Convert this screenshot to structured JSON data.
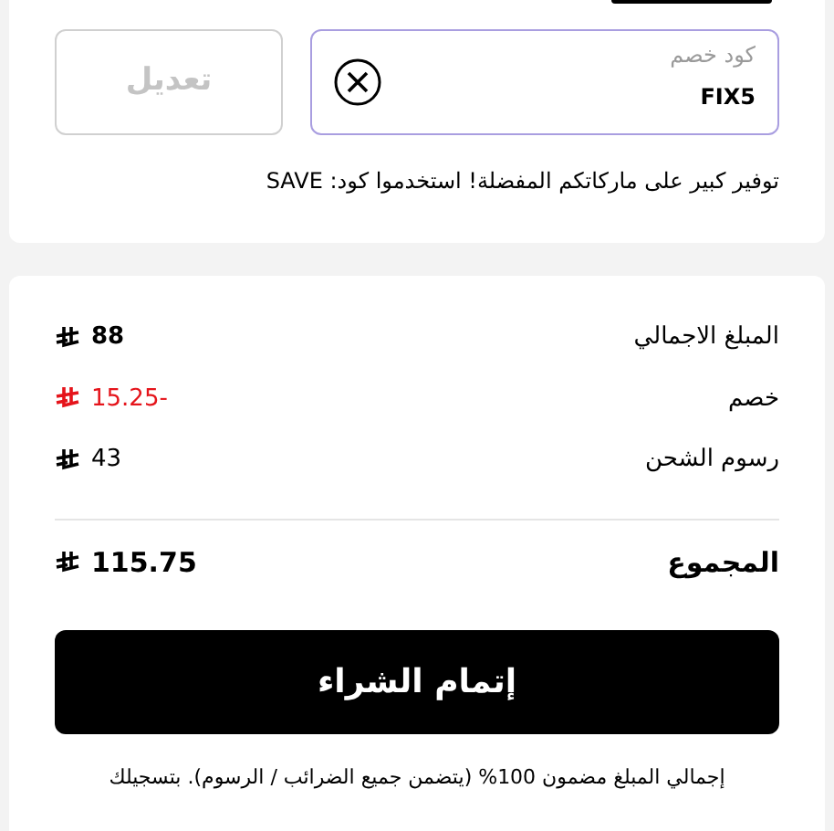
{
  "coupon": {
    "label": "كود خصم",
    "value": "FIX5",
    "edit_button": {
      "label": "تعديل",
      "disabled": true
    }
  },
  "promo_text": "توفير كبير على ماركاتكم المفضلة! استخدموا كود: SAVE",
  "summary": {
    "rows": [
      {
        "label": "المبلغ الاجمالي",
        "amount": "88",
        "kind": "bold"
      },
      {
        "label": "خصم",
        "amount": "15.25-",
        "kind": "discount"
      },
      {
        "label": "رسوم الشحن",
        "amount": "43",
        "kind": "normal"
      }
    ],
    "total": {
      "label": "المجموع",
      "amount": "115.75"
    }
  },
  "checkout_button": "إتمام الشراء",
  "footer_note": "إجمالي المبلغ مضمون 100% (يتضمن جميع الضرائب / الرسوم). بتسجيلك"
}
